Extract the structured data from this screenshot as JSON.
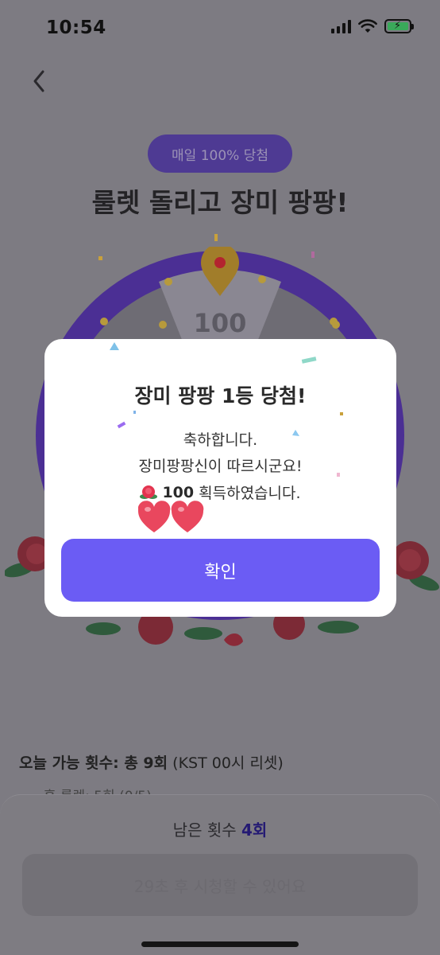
{
  "status_bar": {
    "time": "10:54"
  },
  "event": {
    "badge": "매일 100% 당첨",
    "headline": "룰렛 돌리고 장미 팡팡!",
    "wheel_top_value": "100"
  },
  "info": {
    "title_bold": "오늘 가능 횟수: 총 9회",
    "title_rest": " (KST 00시 리셋)",
    "sub": "· 홈 룰렛: 5회 (0/5)"
  },
  "bottom_sheet": {
    "remaining_label": "남은 횟수 ",
    "remaining_count": "4회",
    "watch_button": "29초 후 시청할 수 있어요"
  },
  "modal": {
    "title": "장미 팡팡 1등 당첨!",
    "line1": "축하합니다.",
    "line2": "장미팡팡신이 따르시군요!",
    "reward_amount": "100",
    "reward_text": "획득하였습니다.",
    "confirm_label": "확인"
  },
  "colors": {
    "accent": "#6b5cf4",
    "wheel_rim": "#4b2f94",
    "rose": "#e3344f",
    "heart": "#e9475e"
  },
  "icons": [
    "back-chevron-icon",
    "signal-icon",
    "wifi-icon",
    "battery-charging-icon",
    "rose-icon",
    "heart-icon",
    "map-pin-icon"
  ]
}
